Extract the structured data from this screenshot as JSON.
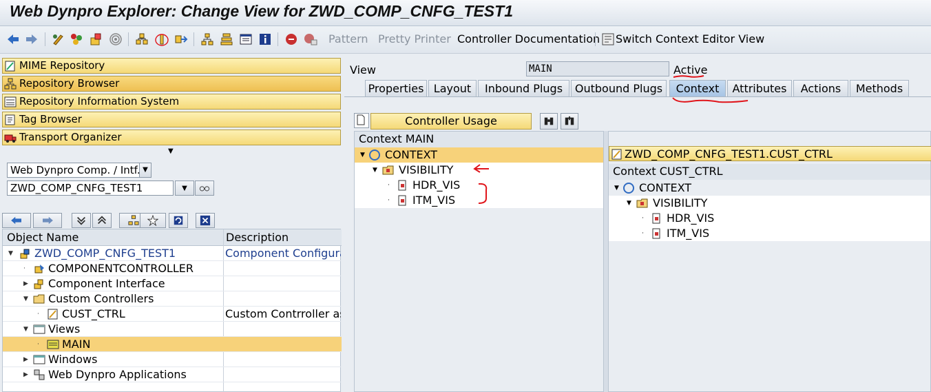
{
  "window": {
    "title": "Web Dynpro Explorer: Change View for ZWD_COMP_CNFG_TEST1"
  },
  "toolbar": {
    "pattern_label": "Pattern",
    "pretty_printer_label": "Pretty Printer",
    "controller_doc_label": "Controller Documentation",
    "switch_context_label": "Switch Context Editor View"
  },
  "nav": {
    "items": [
      {
        "label": "MIME Repository"
      },
      {
        "label": "Repository Browser"
      },
      {
        "label": "Repository Information System"
      },
      {
        "label": "Tag Browser"
      },
      {
        "label": "Transport Organizer"
      }
    ]
  },
  "selector": {
    "type_value": "Web Dynpro Comp. / Intf.",
    "name_value": "ZWD_COMP_CNFG_TEST1"
  },
  "object_tree": {
    "headers": {
      "name": "Object Name",
      "description": "Description"
    },
    "rows": [
      {
        "name": "ZWD_COMP_CNFG_TEST1",
        "description": "Component Configuratio"
      },
      {
        "name": "COMPONENTCONTROLLER",
        "description": ""
      },
      {
        "name": "Component Interface",
        "description": ""
      },
      {
        "name": "Custom Controllers",
        "description": ""
      },
      {
        "name": "CUST_CTRL",
        "description": "Custom Contrroller as co"
      },
      {
        "name": "Views",
        "description": ""
      },
      {
        "name": "MAIN",
        "description": ""
      },
      {
        "name": "Windows",
        "description": ""
      },
      {
        "name": "Web Dynpro Applications",
        "description": ""
      }
    ]
  },
  "view_header": {
    "label": "View",
    "name_value": "MAIN",
    "status": "Active"
  },
  "tabs": [
    {
      "label": "Properties"
    },
    {
      "label": "Layout"
    },
    {
      "label": "Inbound Plugs"
    },
    {
      "label": "Outbound Plugs"
    },
    {
      "label": "Context"
    },
    {
      "label": "Attributes"
    },
    {
      "label": "Actions"
    },
    {
      "label": "Methods"
    }
  ],
  "context_editor": {
    "controller_usage_label": "Controller Usage",
    "left": {
      "header": "Context MAIN",
      "nodes": [
        {
          "label": "CONTEXT"
        },
        {
          "label": "VISIBILITY"
        },
        {
          "label": "HDR_VIS"
        },
        {
          "label": "ITM_VIS"
        }
      ]
    },
    "right": {
      "controller": "ZWD_COMP_CNFG_TEST1.CUST_CTRL",
      "header": "Context CUST_CTRL",
      "nodes": [
        {
          "label": "CONTEXT"
        },
        {
          "label": "VISIBILITY"
        },
        {
          "label": "HDR_VIS"
        },
        {
          "label": "ITM_VIS"
        }
      ]
    }
  },
  "colors": {
    "selection": "#f7d27a",
    "annotation": "#e0141a",
    "tab_active": "#b7d0ec"
  }
}
